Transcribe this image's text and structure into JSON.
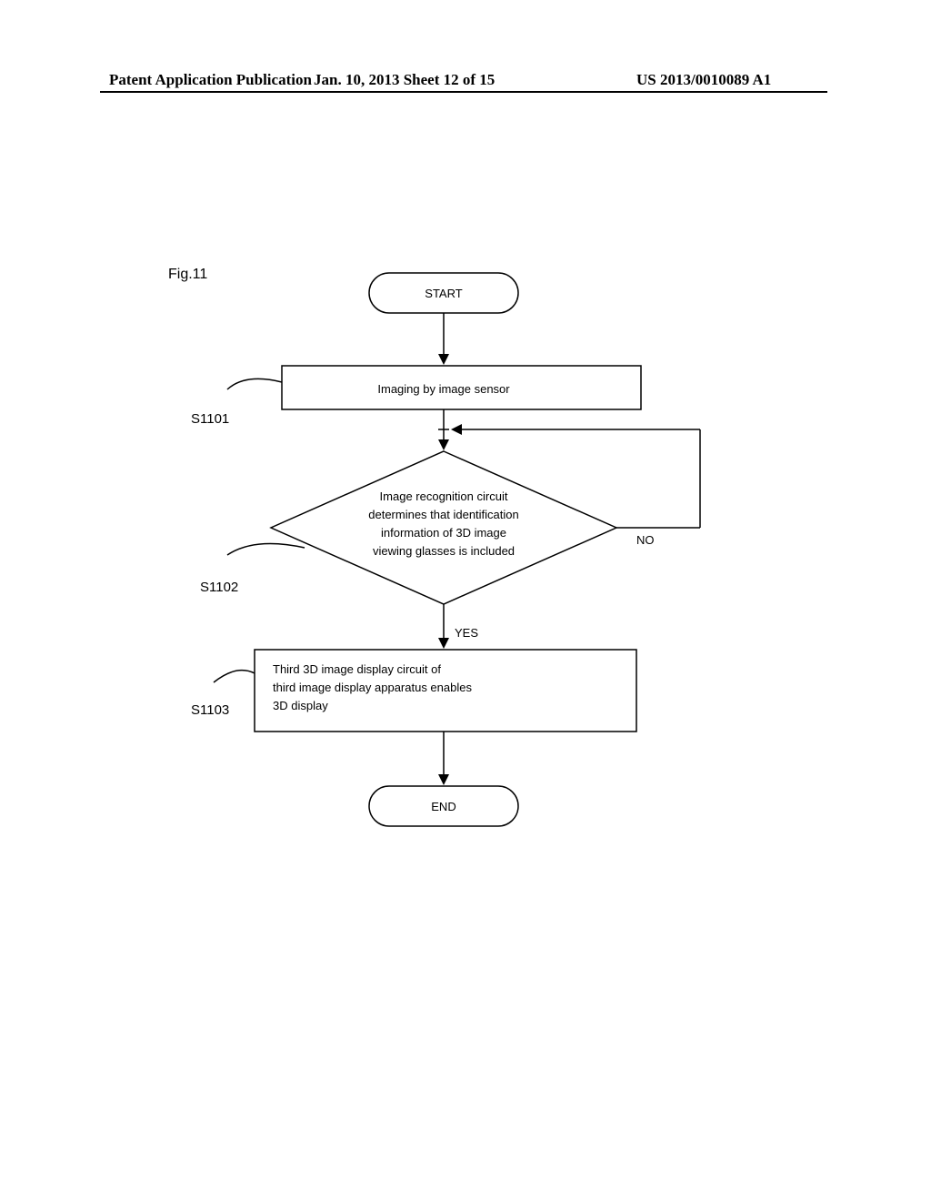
{
  "header": {
    "left": "Patent Application Publication",
    "center": "Jan. 10, 2013  Sheet 12 of 15",
    "right": "US 2013/0010089 A1"
  },
  "figure_label": "Fig.11",
  "flowchart": {
    "start": "START",
    "end": "END",
    "step1": {
      "label": "S1101",
      "text": "Imaging  by image  sensor"
    },
    "step2": {
      "label": "S1102",
      "line1": "Image recognition circuit",
      "line2": "determines that identification",
      "line3": "information of 3D image",
      "line4": "viewing glasses is included",
      "yes": "YES",
      "no": "NO"
    },
    "step3": {
      "label": "S1103",
      "line1": "Third 3D image  display  circuit of",
      "line2": "third image  display apparatus enables",
      "line3": "3D display"
    }
  }
}
